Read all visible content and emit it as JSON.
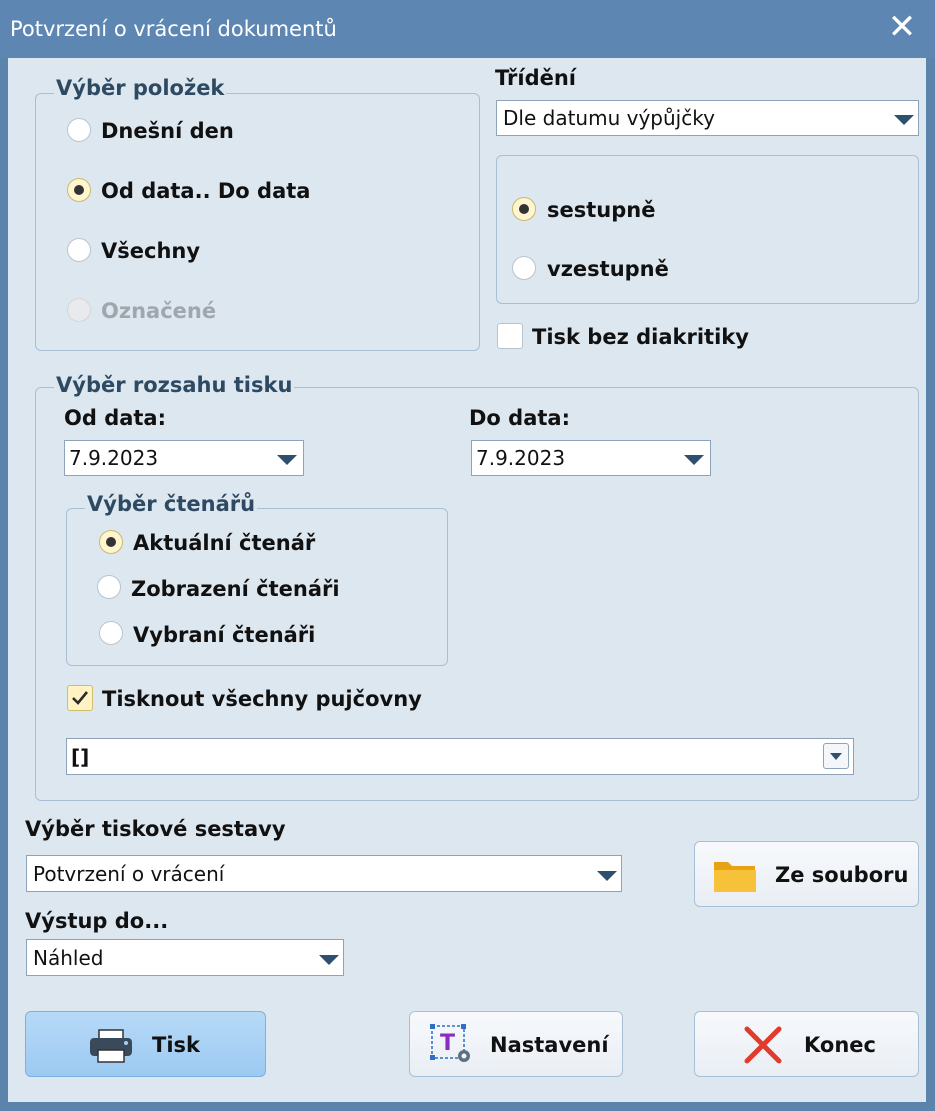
{
  "window": {
    "title": "Potvrzení o vrácení dokumentů",
    "close_glyph": "✕"
  },
  "selection": {
    "legend": "Výběr položek",
    "options": [
      {
        "label": "Dnešní den",
        "checked": false,
        "enabled": true
      },
      {
        "label": "Od data.. Do data",
        "checked": true,
        "enabled": true
      },
      {
        "label": "Všechny",
        "checked": false,
        "enabled": true
      },
      {
        "label": "Označené",
        "checked": false,
        "enabled": false
      }
    ]
  },
  "sorting": {
    "label": "Třídění",
    "value": "Dle datumu výpůjčky",
    "order_options": [
      {
        "label": "sestupně",
        "checked": true
      },
      {
        "label": "vzestupně",
        "checked": false
      }
    ]
  },
  "print_without_diacritics": {
    "label": "Tisk bez diakritiky",
    "checked": false
  },
  "range": {
    "legend": "Výběr rozsahu tisku",
    "from_label": "Od data:",
    "from_value": "7.9.2023",
    "to_label": "Do data:",
    "to_value": "7.9.2023",
    "readers": {
      "legend": "Výběr čtenářů",
      "options": [
        {
          "label": "Aktuální čtenář",
          "checked": true
        },
        {
          "label": "Zobrazení čtenáři",
          "checked": false
        },
        {
          "label": "Vybraní čtenáři",
          "checked": false
        }
      ]
    },
    "all_branches": {
      "label": "Tisknout všechny pujčovny",
      "checked": true
    },
    "branches_value": "[]"
  },
  "report": {
    "label": "Výběr tiskové sestavy",
    "value": "Potvrzení o vrácení",
    "from_file_label": "Ze souboru"
  },
  "output": {
    "label": "Výstup do...",
    "value": "Náhled"
  },
  "buttons": {
    "print": "Tisk",
    "settings": "Nastavení",
    "close": "Konec"
  },
  "colors": {
    "titlebar": "#5d87b2",
    "client": "#dde7f0",
    "primary_button": "#a9d1f5",
    "close_icon": "#e03b2c",
    "folder_icon": "#f6b92b"
  },
  "icons": {
    "printer": "printer-icon",
    "settings": "template-settings-icon",
    "close": "red-x-icon",
    "folder": "folder-icon"
  }
}
